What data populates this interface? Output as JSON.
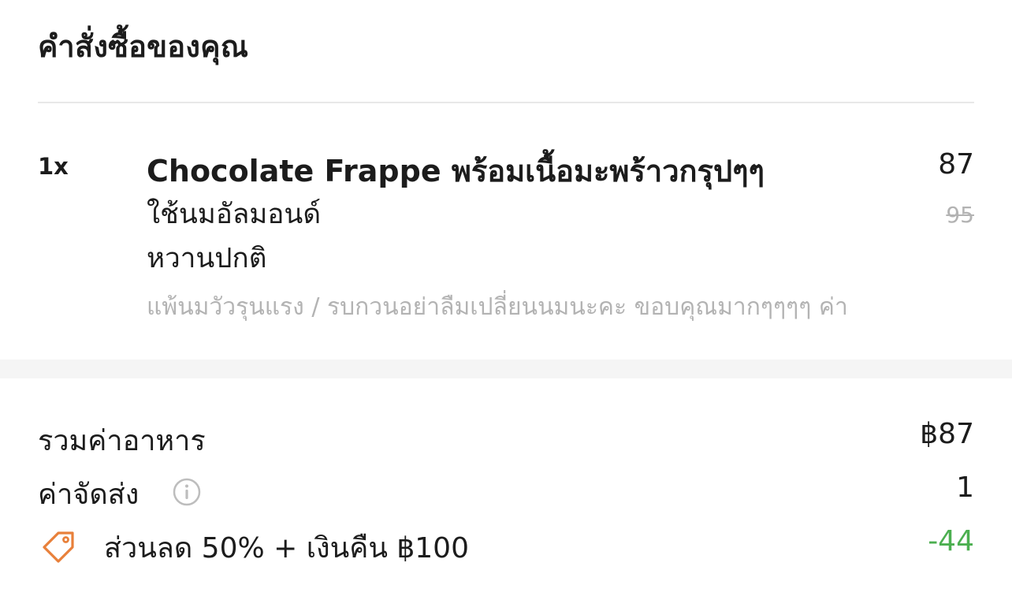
{
  "header": {
    "title": "คำสั่งซื้อของคุณ"
  },
  "item": {
    "quantity": "1x",
    "name": "Chocolate Frappe พร้อมเนื้อมะพร้าวกรุปๆๆ",
    "options": [
      "ใช้นมอัลมอนด์",
      "หวานปกติ"
    ],
    "note": "แพ้นมวัวรุนแรง / รบกวนอย่าลืมเปลี่ยนนมนะคะ ขอบคุณมากๆๆๆๆ ค่า",
    "price": "87",
    "original_price": "95"
  },
  "summary": {
    "food_total_label": "รวมค่าอาหาร",
    "food_total_value": "฿87",
    "delivery_fee_label": "ค่าจัดส่ง",
    "delivery_fee_value": "1",
    "discount_label": "ส่วนลด 50% + เงินคืน ฿100",
    "discount_value": "-44"
  },
  "icons": {
    "info": "info-icon",
    "discount": "tag-icon"
  },
  "colors": {
    "discount_value": "#4caf50",
    "tag_icon": "#e8803a",
    "muted_text": "#b3b3b3"
  }
}
